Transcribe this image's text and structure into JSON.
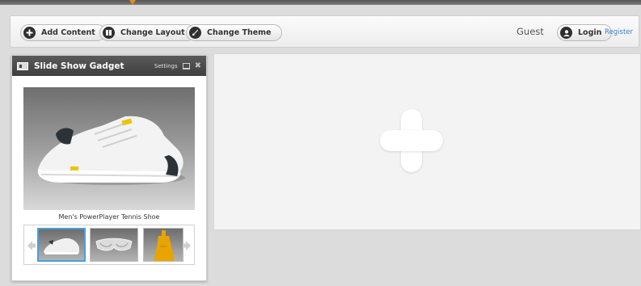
{
  "toolbar": {
    "add_content_label": "Add Content",
    "change_layout_label": "Change Layout",
    "change_theme_label": "Change Theme",
    "guest_label": "Guest",
    "login_label": "Login",
    "register_label": "Register"
  },
  "gadget": {
    "title": "Slide Show Gadget",
    "settings_label": "Settings",
    "caption": "Men's PowerPlayer Tennis Shoe",
    "thumbnails": [
      {
        "icon": "shoe-thumbnail",
        "selected": true
      },
      {
        "icon": "sunglasses-thumbnail",
        "selected": false
      },
      {
        "icon": "dress-thumbnail",
        "selected": false
      }
    ]
  },
  "canvas": {
    "icon": "plus-icon"
  },
  "colors": {
    "accent_link": "#3c7ec7",
    "header_dark": "#4a4a4a",
    "thumb_selected_border": "#4a9fd8",
    "dress_yellow": "#e8a400",
    "top_arrow": "#e38b1c"
  }
}
